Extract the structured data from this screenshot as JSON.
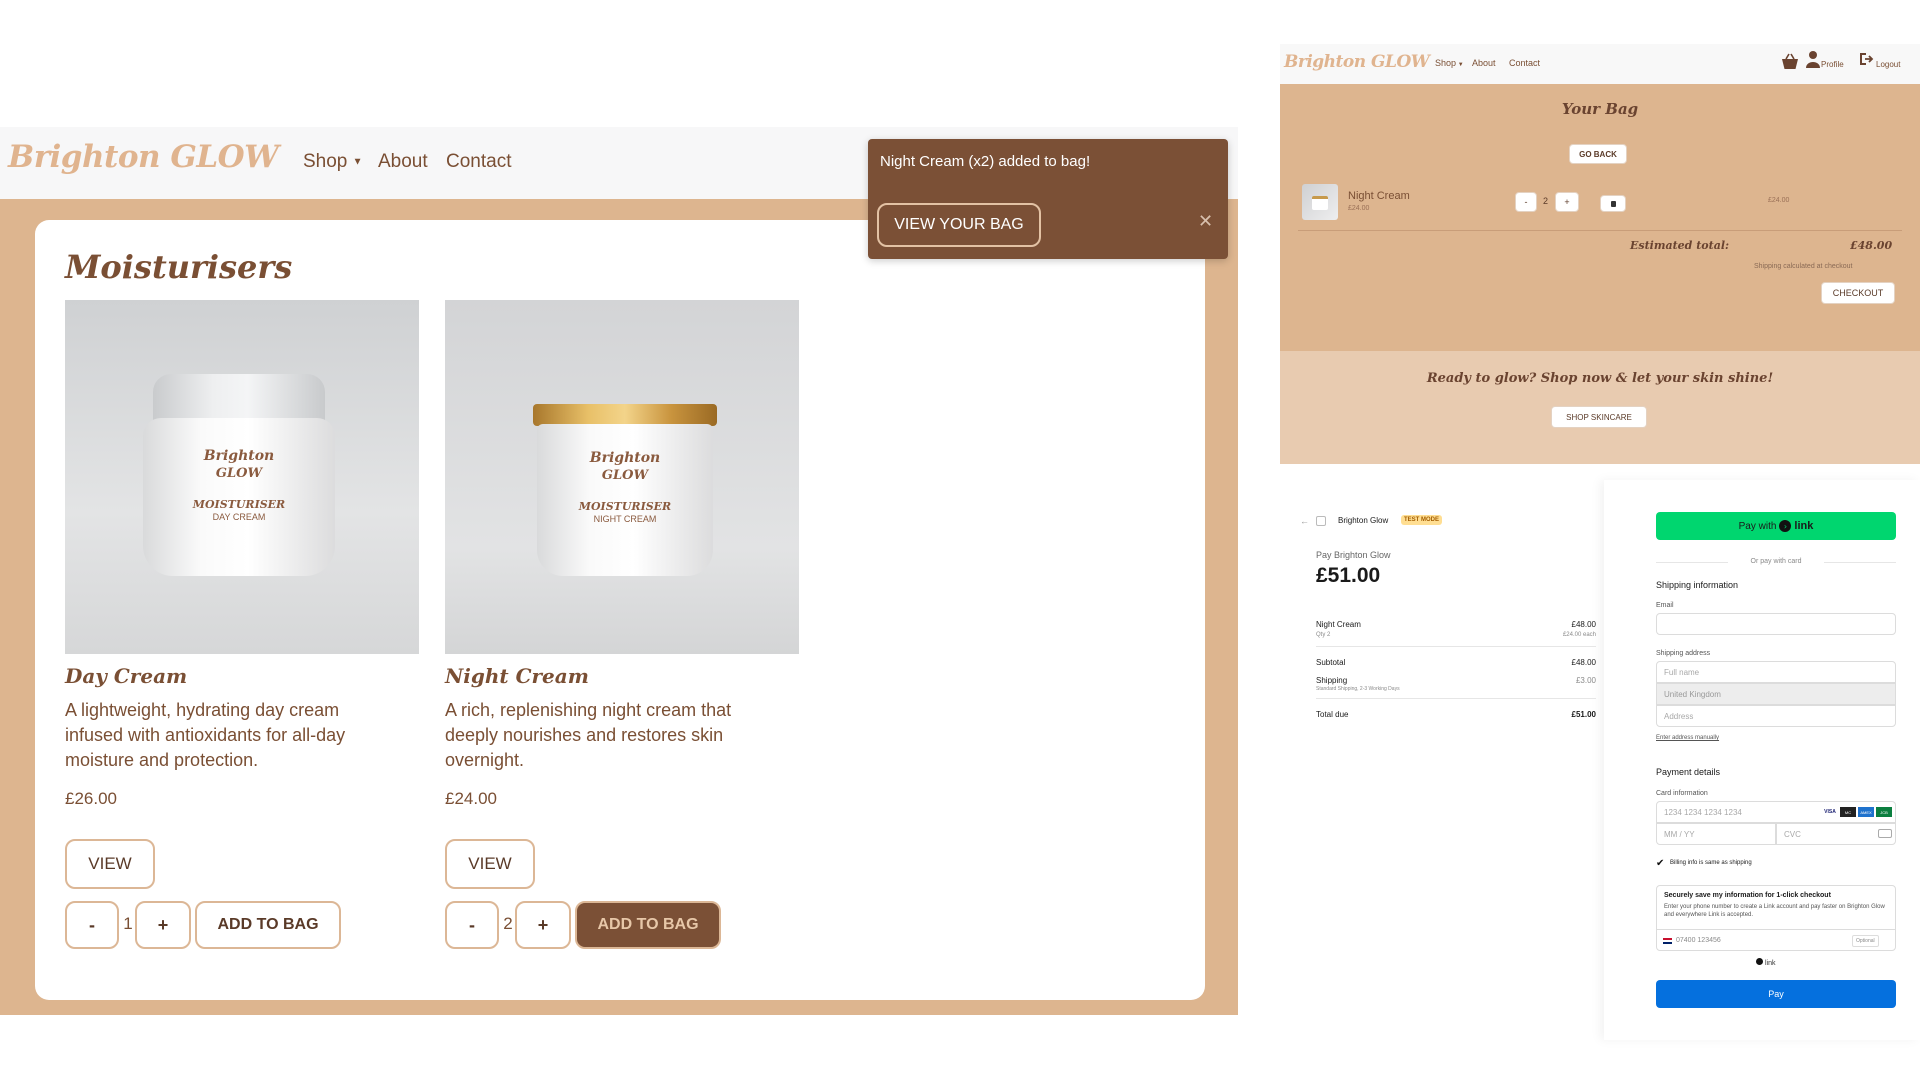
{
  "left": {
    "nav": {
      "brand": "Brighton GLOW",
      "shop": "Shop",
      "about": "About",
      "contact": "Contact"
    },
    "section_title": "Moisturisers",
    "products": [
      {
        "name": "Day Cream",
        "jar_brand_top": "Brighton",
        "jar_brand_bottom": "GLOW",
        "jar_label": "MOISTURISER",
        "jar_sub": "DAY CREAM",
        "description": "A lightweight, hydrating day cream infused with antioxidants for all-day moisture and protection.",
        "price": "£26.00",
        "view_label": "VIEW",
        "minus": "-",
        "qty": "1",
        "plus": "+",
        "add_label": "ADD TO BAG"
      },
      {
        "name": "Night Cream",
        "jar_brand_top": "Brighton",
        "jar_brand_bottom": "GLOW",
        "jar_label": "MOISTURISER",
        "jar_sub": "NIGHT CREAM",
        "description": "A rich, replenishing night cream that deeply nourishes and restores skin overnight.",
        "price": "£24.00",
        "view_label": "VIEW",
        "minus": "-",
        "qty": "2",
        "plus": "+",
        "add_label": "ADD TO BAG"
      }
    ],
    "toast": {
      "message": "Night Cream (x2) added to bag!",
      "button": "VIEW YOUR BAG",
      "close": "✕"
    }
  },
  "right_top": {
    "nav": {
      "brand": "Brighton GLOW",
      "shop": "Shop",
      "about": "About",
      "contact": "Contact",
      "profile": "Profile",
      "logout": "Logout"
    },
    "bag_title": "Your Bag",
    "go_back": "GO BACK",
    "item": {
      "name": "Night Cream",
      "unit_price": "£24.00",
      "minus": "-",
      "qty": "2",
      "plus": "+",
      "line_total": "£24.00"
    },
    "estimated_label": "Estimated total:",
    "estimated_value": "£48.00",
    "shipping_note": "Shipping calculated at checkout",
    "checkout": "CHECKOUT",
    "promo": "Ready to glow? Shop now & let your skin shine!",
    "shop_skincare": "SHOP SKINCARE"
  },
  "checkout": {
    "merchant": "Brighton Glow",
    "test_mode": "TEST MODE",
    "pay_to": "Pay Brighton Glow",
    "amount": "£51.00",
    "line_item": {
      "name": "Night Cream",
      "qty": "Qty 2",
      "total": "£48.00",
      "each": "£24.00 each"
    },
    "subtotal_label": "Subtotal",
    "subtotal": "£48.00",
    "shipping_label": "Shipping",
    "shipping_desc": "Standard Shipping, 2-3 Working Days",
    "shipping": "£3.00",
    "total_label": "Total due",
    "total": "£51.00",
    "pay_with": "Pay with",
    "link": "link",
    "or_card": "Or pay with card",
    "shipping_info": "Shipping information",
    "email_label": "Email",
    "address_label": "Shipping address",
    "full_name": "Full name",
    "country": "United Kingdom",
    "address": "Address",
    "manual": "Enter address manually",
    "payment_details": "Payment details",
    "card_info": "Card information",
    "card_number": "1234 1234 1234 1234",
    "card_brands": [
      "VISA",
      "MC",
      "AMEX",
      "JCB"
    ],
    "expiry": "MM / YY",
    "cvc": "CVC",
    "billing_same": "Billing info is same as shipping",
    "save_title": "Securely save my information for 1-click checkout",
    "save_desc": "Enter your phone number to create a Link account and pay faster on Brighton Glow and everywhere Link is accepted.",
    "phone": "07400 123456",
    "optional": "Optional",
    "link_small": "link",
    "pay": "Pay"
  },
  "colors": {
    "brown": "#7b5036",
    "tan": "#ddb58f",
    "link_green": "#00d66f",
    "stripe_blue": "#0570de"
  }
}
